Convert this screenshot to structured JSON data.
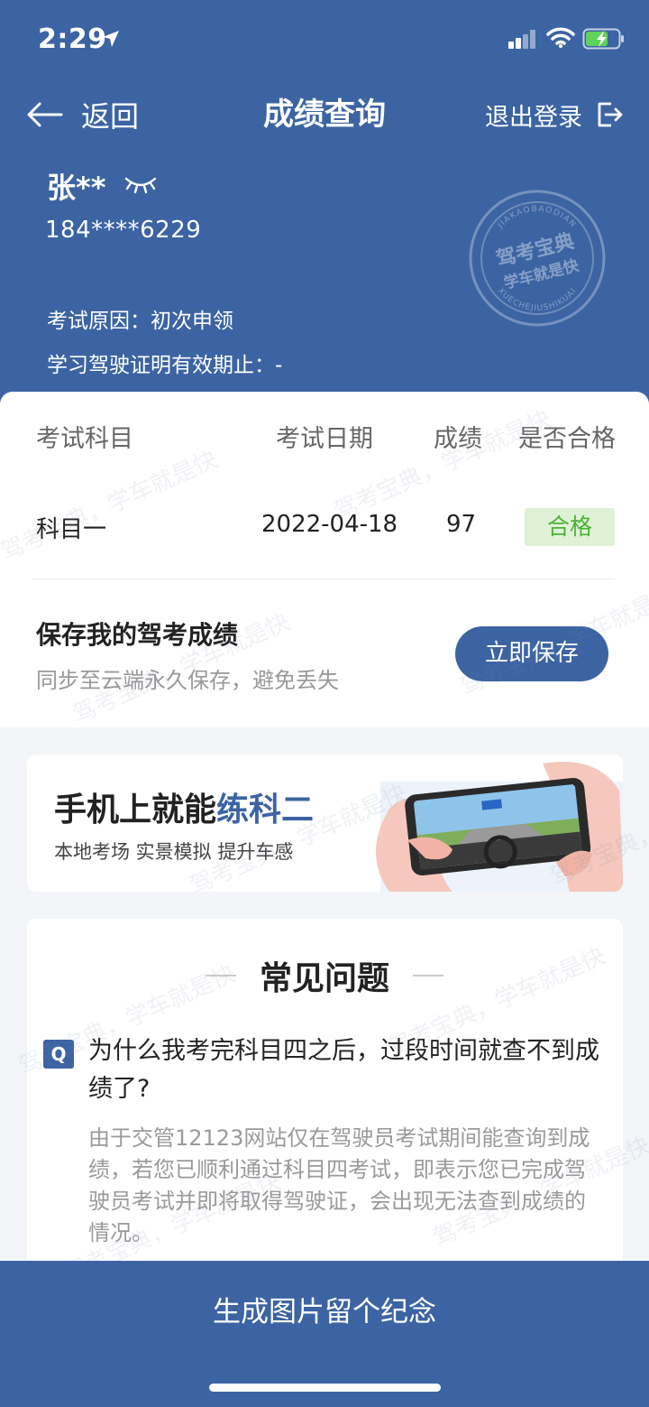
{
  "status_bar": {
    "time": "2:29"
  },
  "nav": {
    "back_label": "返回",
    "title": "成绩查询",
    "logout_label": "退出登录"
  },
  "user": {
    "name": "张**",
    "phone": "184****6229",
    "exam_reason": "考试原因：初次申领",
    "license_valid": "学习驾驶证明有效期止：-"
  },
  "stamp": {
    "top_text": "JIAKAOBAODIAN",
    "line1": "驾考宝典",
    "line2": "学车就是快",
    "bottom_text": "XUECHEJIUSHIKUAI"
  },
  "score_table": {
    "headers": [
      "考试科目",
      "考试日期",
      "成绩",
      "是否合格"
    ],
    "rows": [
      {
        "subject": "科目一",
        "date": "2022-04-18",
        "score": "97",
        "result": "合格"
      }
    ]
  },
  "save_section": {
    "title": "保存我的驾考成绩",
    "subtitle": "同步至云端永久保存，避免丢失",
    "button_label": "立即保存"
  },
  "promo": {
    "title_prefix": "手机上就能",
    "title_accent": "练科二",
    "subtitle": "本地考场 实景模拟 提升车感"
  },
  "faq": {
    "heading": "常见问题",
    "question": "为什么我考完科目四之后，过段时间就查不到成绩了?",
    "answer": "由于交管12123网站仅在驾驶员考试期间能查询到成绩，若您已顺利通过科目四考试，即表示您已完成驾驶员考试并即将取得驾驶证，会出现无法查到成绩的情况。",
    "q_badge": "Q"
  },
  "bottom": {
    "button_label": "生成图片留个纪念"
  },
  "watermark": "驾考宝典，学车就是快",
  "colors": {
    "brand": "#3c64a3",
    "pass_green": "#4eb038",
    "pass_bg": "#dff2d6"
  }
}
